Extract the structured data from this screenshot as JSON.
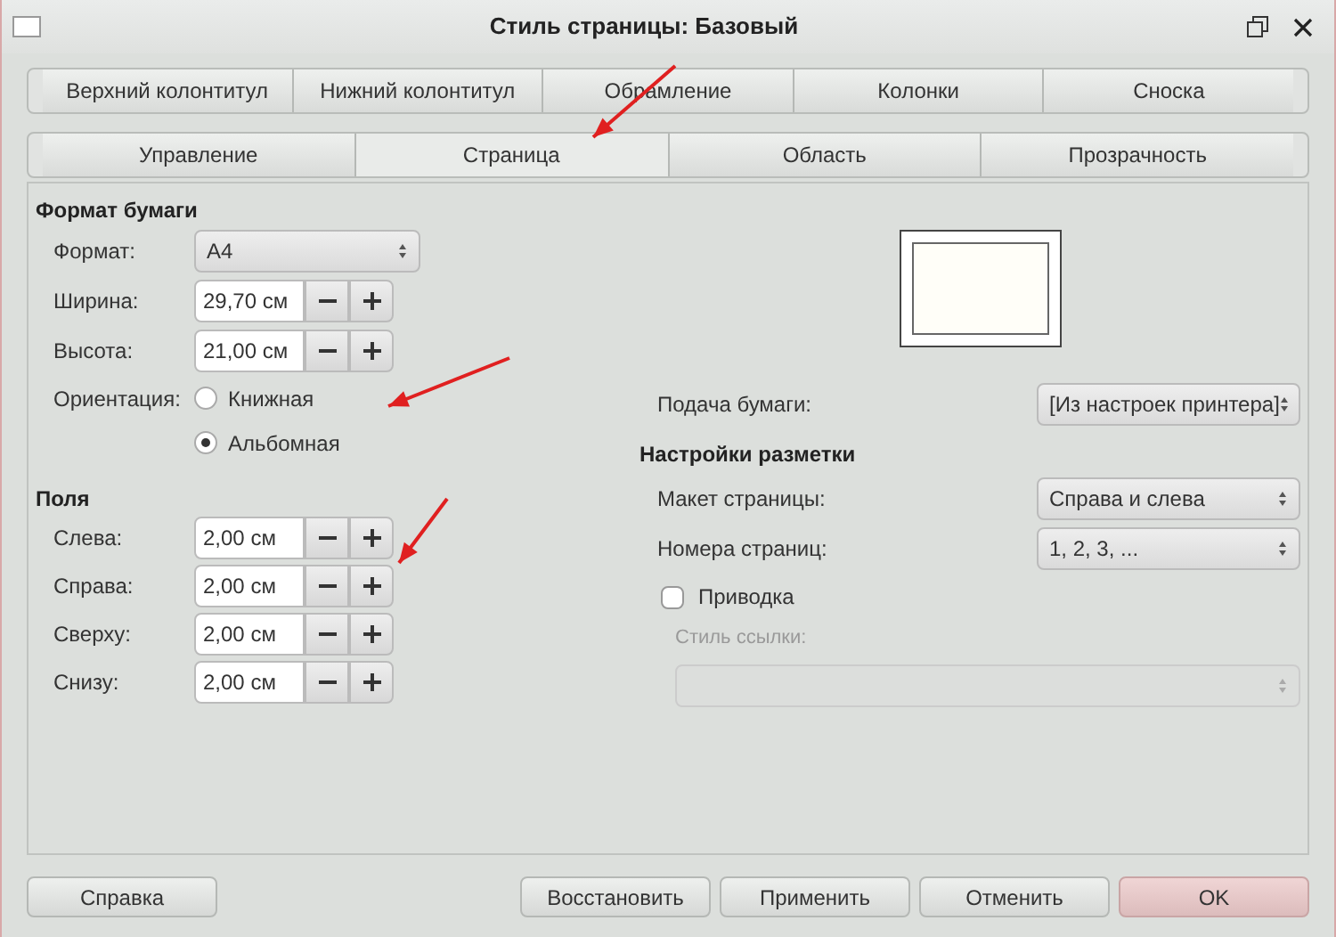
{
  "window": {
    "title": "Стиль страницы: Базовый"
  },
  "tabs_top": [
    {
      "label": "Верхний колонтитул",
      "selected": false
    },
    {
      "label": "Нижний колонтитул",
      "selected": false
    },
    {
      "label": "Обрамление",
      "selected": false
    },
    {
      "label": "Колонки",
      "selected": false
    },
    {
      "label": "Сноска",
      "selected": false
    }
  ],
  "tabs_bottom": [
    {
      "label": "Управление",
      "selected": false
    },
    {
      "label": "Страница",
      "selected": true
    },
    {
      "label": "Область",
      "selected": false
    },
    {
      "label": "Прозрачность",
      "selected": false
    }
  ],
  "paper_format": {
    "heading": "Формат бумаги",
    "format_label": "Формат:",
    "format_value": "A4",
    "sizes": [
      {
        "label": "Ширина:",
        "value": "29,70 см"
      },
      {
        "label": "Высота:",
        "value": "21,00 см"
      }
    ],
    "orientation_label": "Ориентация:",
    "orientations": [
      {
        "label": "Книжная",
        "selected": false
      },
      {
        "label": "Альбомная",
        "selected": true
      }
    ],
    "paper_tray_label": "Подача бумаги:",
    "paper_tray_value": "[Из настроек принтера]"
  },
  "margins": {
    "heading": "Поля",
    "items": [
      {
        "label": "Слева:",
        "value": "2,00 см"
      },
      {
        "label": "Справа:",
        "value": "2,00 см"
      },
      {
        "label": "Сверху:",
        "value": "2,00 см"
      },
      {
        "label": "Снизу:",
        "value": "2,00 см"
      }
    ]
  },
  "layout_settings": {
    "heading": "Настройки разметки",
    "page_layout_label": "Макет страницы:",
    "page_layout_value": "Справа и слева",
    "page_numbers_label": "Номера страниц:",
    "page_numbers_value": "1, 2, 3, ...",
    "register_true": {
      "label": "Приводка",
      "checked": false
    },
    "reference_style_label": "Стиль ссылки:",
    "reference_style_disabled": true
  },
  "buttons_left": [
    {
      "label": "Справка",
      "default": false
    }
  ],
  "buttons_right": [
    {
      "label": "Восстановить",
      "default": false
    },
    {
      "label": "Применить",
      "default": false
    },
    {
      "label": "Отменить",
      "default": false
    },
    {
      "label": "OK",
      "default": true
    }
  ]
}
